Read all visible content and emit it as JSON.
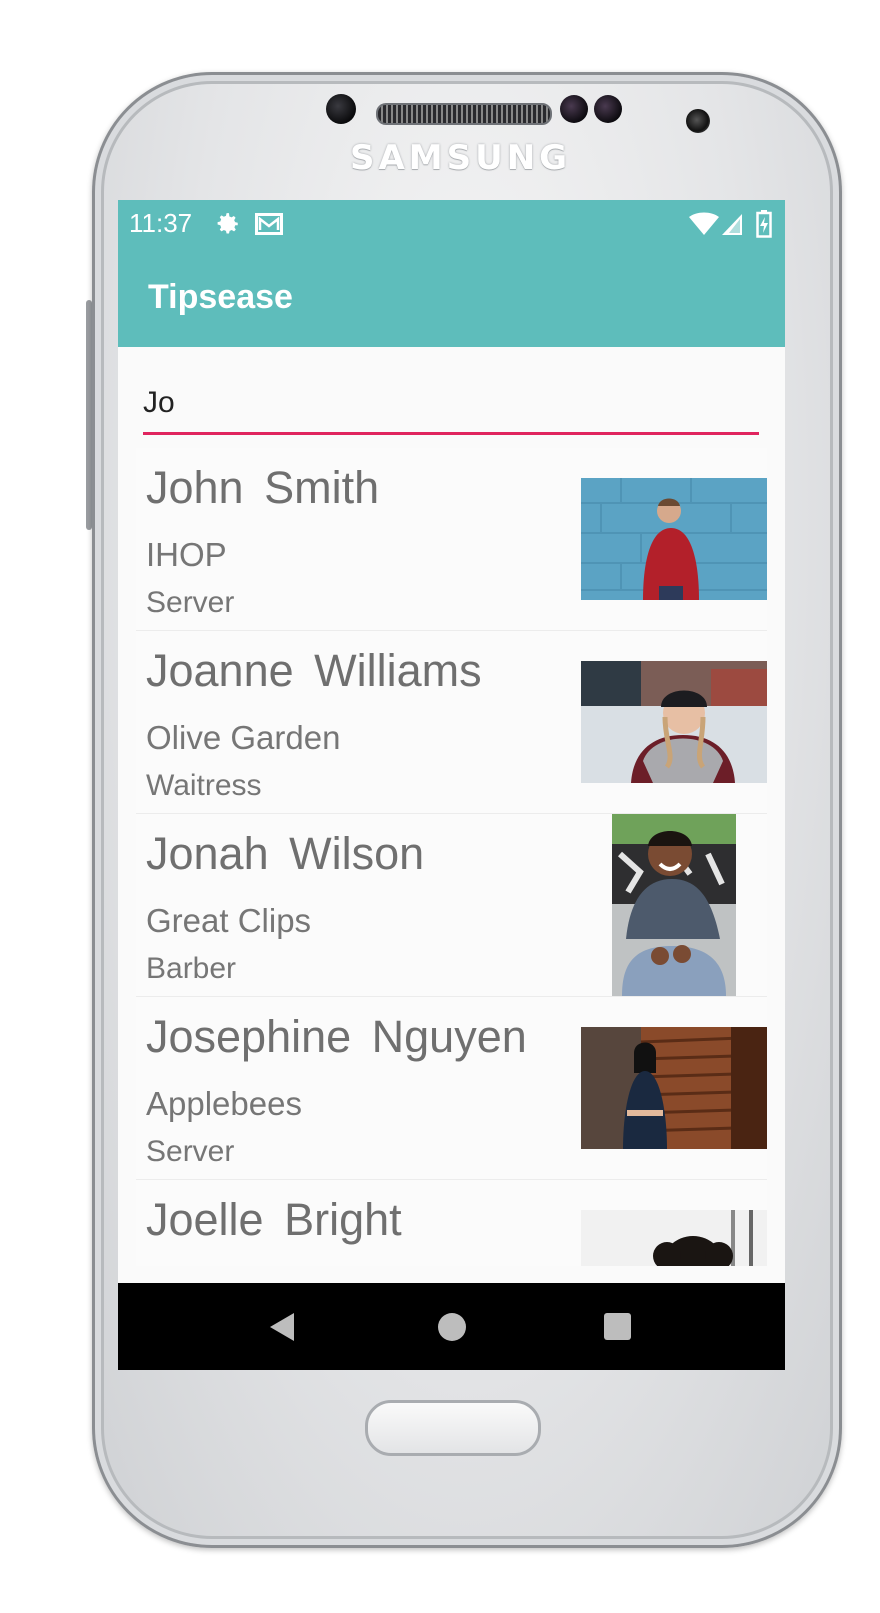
{
  "device": {
    "brand": "SAMSUNG"
  },
  "status_bar": {
    "time": "11:37",
    "icons": [
      "gear-icon",
      "mail-icon",
      "wifi-icon",
      "signal-icon",
      "battery-icon"
    ]
  },
  "app_bar": {
    "title": "Tipsease"
  },
  "search": {
    "value": "Jo",
    "underline_color": "#e0245e"
  },
  "results": [
    {
      "name": "John Smith",
      "place": "IHOP",
      "role": "Server"
    },
    {
      "name": "Joanne Williams",
      "place": "Olive Garden",
      "role": "Waitress"
    },
    {
      "name": "Jonah Wilson",
      "place": "Great Clips",
      "role": "Barber"
    },
    {
      "name": "Josephine Nguyen",
      "place": "Applebees",
      "role": "Server"
    },
    {
      "name": "Joelle Bright",
      "place": "",
      "role": ""
    }
  ],
  "nav_bar": {
    "icons": [
      "back-icon",
      "home-icon",
      "recents-icon"
    ]
  },
  "colors": {
    "primary": "#5ebdbb",
    "accent": "#e0245e",
    "text_secondary": "#6f6f6f"
  }
}
